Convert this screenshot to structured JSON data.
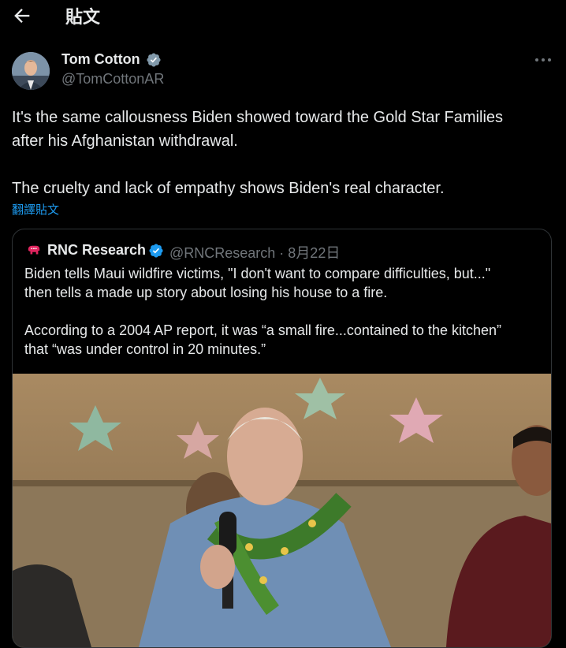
{
  "header": {
    "back_icon": "arrow-left-icon",
    "title": "貼文"
  },
  "tweet": {
    "author_name": "Tom Cotton",
    "author_handle": "@TomCottonAR",
    "verified_icon": "verified-badge-icon",
    "more_icon": "more-horizontal-icon",
    "text": "It's the same callousness Biden showed toward the Gold Star Families\nafter his Afghanistan withdrawal.\n\nThe cruelty and lack of empathy shows Biden's real character.",
    "translate_label": "翻譯貼文"
  },
  "quote": {
    "logo_icon": "republican-elephant-icon",
    "author_name": "RNC Research",
    "author_handle": "@RNCResearch",
    "separator": "·",
    "date": "8月22日",
    "meta": "@RNCResearch · 8月22日",
    "text": "Biden tells Maui wildfire victims, \"I don't want to compare difficulties, but...\"\nthen tells a made up story about losing his house to a fire.\n\nAccording to a 2004 AP report, it was “a small fire...contained to the kitchen”\nthat “was under control in 20 minutes.”"
  },
  "colors": {
    "background": "#000000",
    "text_primary": "#e7e9ea",
    "text_secondary": "#71767b",
    "accent": "#1d9bf0",
    "border": "#2f3336"
  }
}
